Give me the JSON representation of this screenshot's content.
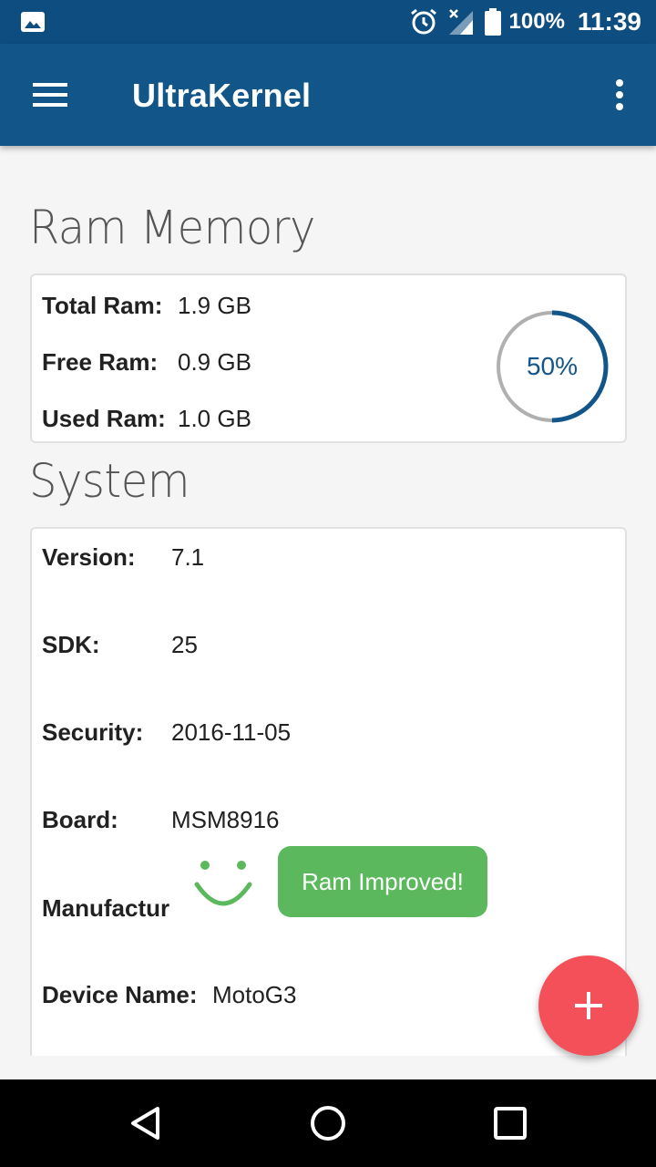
{
  "status_bar": {
    "battery": "100%",
    "time": "11:39",
    "icons": [
      "gallery-icon",
      "alarm-icon",
      "signal-icon",
      "battery-icon"
    ]
  },
  "toolbar": {
    "title": "UltraKernel",
    "icons": [
      "menu-icon",
      "overflow-icon"
    ]
  },
  "ram": {
    "section_title": "Ram Memory",
    "total_label": "Total Ram:",
    "total_value": "1.9 GB",
    "free_label": "Free Ram:",
    "free_value": "0.9 GB",
    "used_label": "Used Ram:",
    "used_value": "1.0 GB",
    "gauge_text": "50%",
    "gauge_fraction": 0.5,
    "gauge_color": "#125588",
    "gauge_track_color": "#b0b0b0"
  },
  "system": {
    "section_title": "System",
    "rows": [
      {
        "label": "Version:",
        "value": "7.1"
      },
      {
        "label": "SDK:",
        "value": "25"
      },
      {
        "label": "Security:",
        "value": "2016-11-05"
      },
      {
        "label": "Board:",
        "value": "MSM8916"
      },
      {
        "label": "Manufactur",
        "value": ""
      },
      {
        "label": "Device Name:",
        "value": "MotoG3"
      }
    ]
  },
  "toast": {
    "message": "Ram Improved!",
    "color": "#5cb85c",
    "icon": "smile-icon"
  },
  "fab": {
    "icon": "plus-icon",
    "color": "#f4505a"
  },
  "colors": {
    "primary": "#125588",
    "primary_dark": "#0e4d80",
    "background": "#f5f5f5"
  },
  "nav_bar": {
    "icons": [
      "back-icon",
      "home-icon",
      "recents-icon"
    ]
  }
}
